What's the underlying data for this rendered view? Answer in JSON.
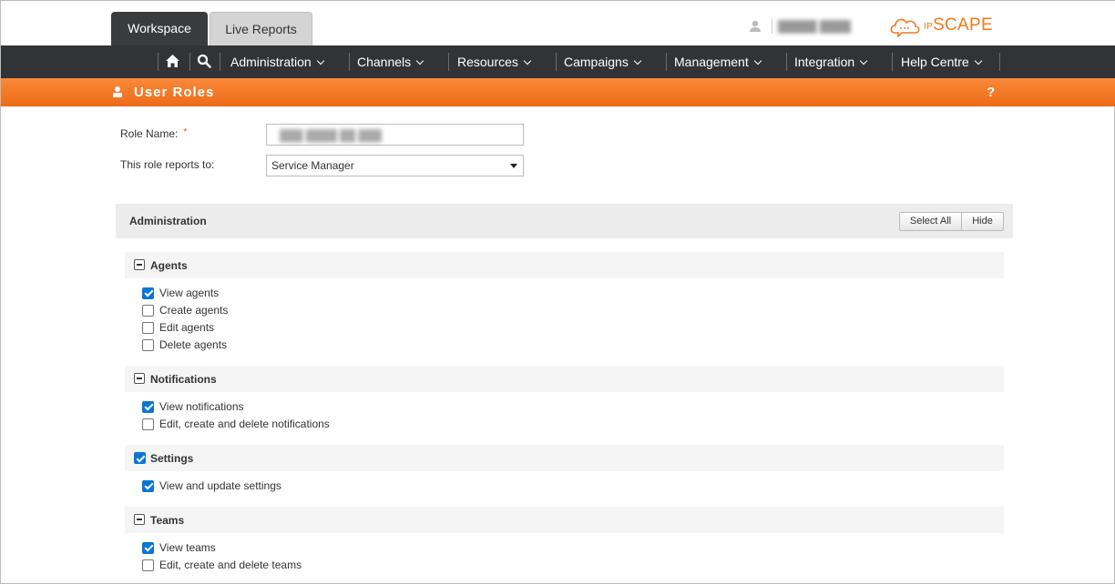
{
  "tabs": [
    {
      "label": "Workspace",
      "active": true
    },
    {
      "label": "Live Reports",
      "active": false
    }
  ],
  "user": {
    "name": "█████ ████"
  },
  "logo": {
    "prefix": "IP",
    "name": "SCAPE",
    "accent": "#f47920"
  },
  "nav": {
    "home_icon": "home-icon",
    "search_icon": "search-icon",
    "items": [
      "Administration",
      "Channels",
      "Resources",
      "Campaigns",
      "Management",
      "Integration",
      "Help Centre"
    ]
  },
  "header": {
    "title": "User Roles",
    "help": "?",
    "accent": "#f47920"
  },
  "form": {
    "role_name_label": "Role Name:",
    "required_marker": "*",
    "role_name_value": "███ ████ ██ ███",
    "reports_to_label": "This role reports to:",
    "reports_to_value": "Service Manager"
  },
  "section": {
    "title": "Administration",
    "select_all": "Select All",
    "hide": "Hide",
    "groups": [
      {
        "title": "Agents",
        "state": "collapse",
        "items": [
          {
            "label": "View agents",
            "checked": true
          },
          {
            "label": "Create agents",
            "checked": false
          },
          {
            "label": "Edit agents",
            "checked": false
          },
          {
            "label": "Delete agents",
            "checked": false
          }
        ]
      },
      {
        "title": "Notifications",
        "state": "collapse",
        "items": [
          {
            "label": "View notifications",
            "checked": true
          },
          {
            "label": "Edit, create and delete notifications",
            "checked": false
          }
        ]
      },
      {
        "title": "Settings",
        "state": "checked",
        "items": [
          {
            "label": "View and update settings",
            "checked": true
          }
        ]
      },
      {
        "title": "Teams",
        "state": "collapse",
        "items": [
          {
            "label": "View teams",
            "checked": true
          },
          {
            "label": "Edit, create and delete teams",
            "checked": false
          }
        ]
      }
    ]
  }
}
